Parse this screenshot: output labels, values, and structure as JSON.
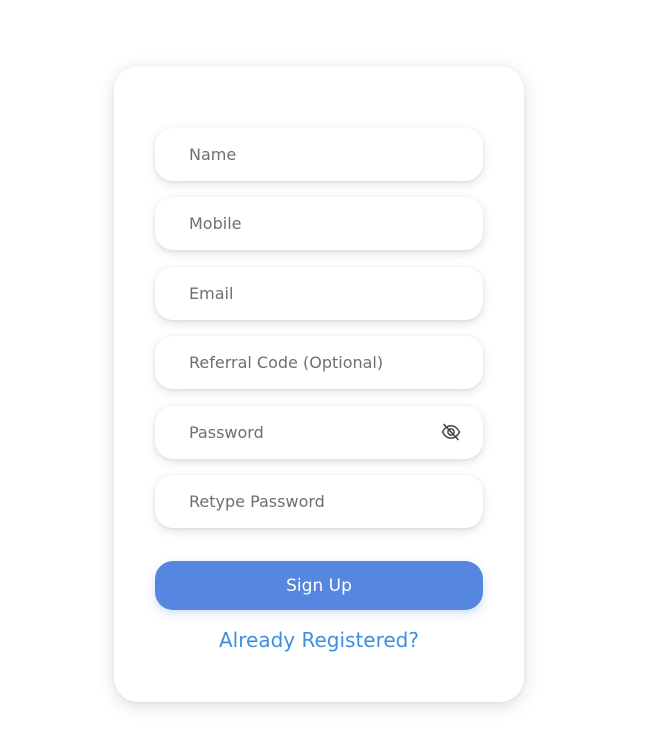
{
  "form": {
    "name_placeholder": "Name",
    "name_value": "",
    "mobile_placeholder": "Mobile",
    "mobile_value": "",
    "email_placeholder": "Email",
    "email_value": "",
    "referral_placeholder": "Referral Code (Optional)",
    "referral_value": "",
    "password_placeholder": "Password",
    "password_value": "",
    "password_toggle_icon": "eye-slash-icon",
    "retype_placeholder": "Retype Password",
    "retype_value": "",
    "submit_label": "Sign Up",
    "login_link": "Already Registered?"
  },
  "colors": {
    "primary": "#5586e0",
    "link": "#3c8ee5",
    "placeholder": "#6f6f6f",
    "background": "#ffffff"
  }
}
